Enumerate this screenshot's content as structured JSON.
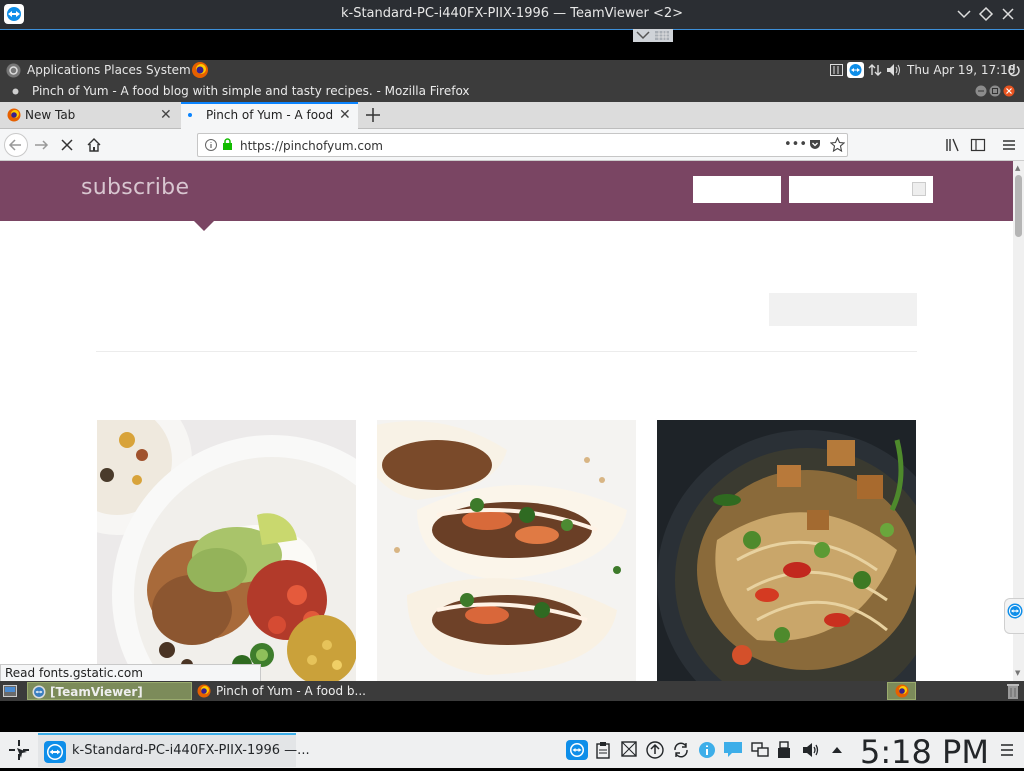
{
  "teamviewer": {
    "window_title": "k-Standard-PC-i440FX-PIIX-1996 — TeamViewer <2>"
  },
  "gnome_panel": {
    "menus": [
      "Applications",
      "Places",
      "System"
    ],
    "clock": "Thu Apr 19, 17:18"
  },
  "firefox": {
    "window_title": "Pinch of Yum - A food blog with simple and tasty recipes. - Mozilla Firefox",
    "tabs": [
      {
        "label": "New Tab"
      },
      {
        "label": "Pinch of Yum - A food bl"
      }
    ],
    "url": "https://pinchofyum.com",
    "status": "Read fonts.gstatic.com"
  },
  "site": {
    "subscribe": "subscribe",
    "brand_color": "#7a4563"
  },
  "gnome_bottom": {
    "tasks": [
      {
        "label": "[TeamViewer]"
      },
      {
        "label": "Pinch of Yum - A food b..."
      }
    ]
  },
  "kde": {
    "task_label": "k-Standard-PC-i440FX-PIIX-1996 —...",
    "clock": "5:18 PM"
  }
}
